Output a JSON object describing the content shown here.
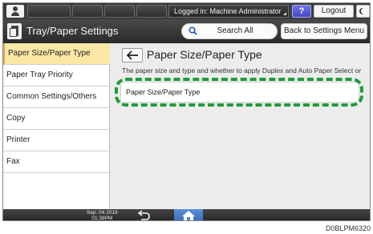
{
  "topbar": {
    "login_status": "Logged in: Machine Administrator",
    "help_label": "?",
    "logout_label": "Logout"
  },
  "titlebar": {
    "app_title": "Tray/Paper Settings",
    "search_all_label": "Search All",
    "back_to_menu_label": "Back to Settings Menu"
  },
  "sidebar": {
    "items": [
      {
        "label": "Paper Size/Paper Type",
        "selected": true
      },
      {
        "label": "Paper Tray Priority",
        "selected": false
      },
      {
        "label": "Common Settings/Others",
        "selected": false
      },
      {
        "label": "Copy",
        "selected": false
      },
      {
        "label": "Printer",
        "selected": false
      },
      {
        "label": "Fax",
        "selected": false
      }
    ]
  },
  "main": {
    "title": "Paper Size/Paper Type",
    "description": "The paper size and type and whether to apply Duplex and Auto Paper Select or",
    "setting_row": "Paper Size/Paper Type"
  },
  "bottombar": {
    "date": "Sep. 04 2019",
    "time": "01:38PM"
  },
  "figure_id": "D0BLPM6320",
  "colors": {
    "selected_bg": "#fbe8a6",
    "highlight": "#1f9b3a",
    "help_button": "#5257d6",
    "home_button": "#4a7fcb"
  }
}
